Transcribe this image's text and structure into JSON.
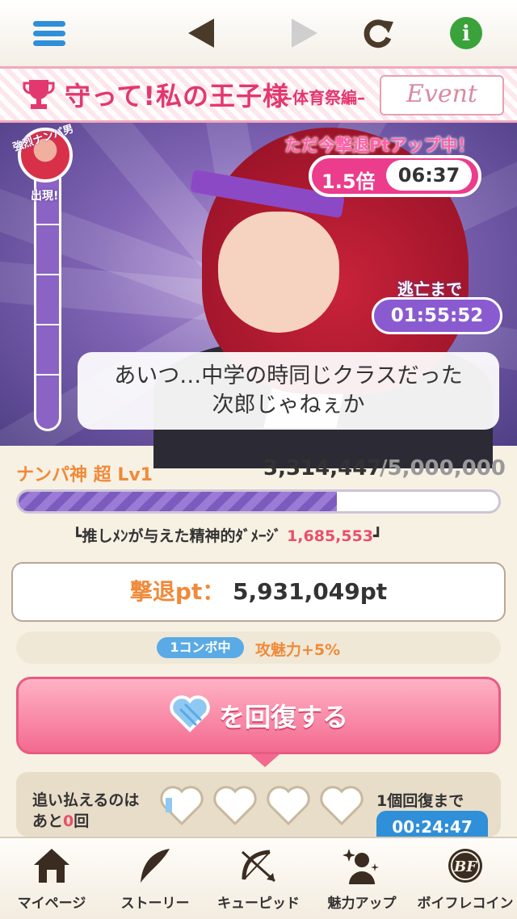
{
  "topbar": {
    "menu_icon": "hamburger-menu-icon",
    "back_icon": "back-arrow-icon",
    "forward_icon": "forward-arrow-icon",
    "reload_icon": "reload-icon",
    "info_icon": "info-icon",
    "info_glyph": "i"
  },
  "event": {
    "title": "守って!私の王子様",
    "subtitle": "–体育祭編–",
    "badge": "Event"
  },
  "gauge": {
    "top_label": "強烈ナンパ男",
    "bottom_label": "出現!",
    "fill_fraction": 1.0
  },
  "boost": {
    "title": "ただ今撃退Ptアップ中！",
    "multiplier": "1.5倍",
    "remaining": "06:37"
  },
  "escape": {
    "label": "逃亡まで",
    "time": "01:55:52"
  },
  "speech": {
    "line1": "あいつ…中学の時同じクラスだった",
    "line2": "次郎じゃねぇか"
  },
  "boss": {
    "name": "ナンパ神 超 Lv1",
    "hp_current": "3,314,447",
    "hp_max": "/5,000,000",
    "hp_fraction": 0.663
  },
  "damage": {
    "label": "┗推しﾒﾝが与えた精神的ﾀﾞﾒｰｼﾞ",
    "value": "1,685,553",
    "end": "┛"
  },
  "points": {
    "label": "撃退pt：",
    "value": "5,931,049pt"
  },
  "combo": {
    "badge": "1コンボ中",
    "bonus": "攻魅力+5%"
  },
  "recover": {
    "label": "を回復する",
    "icon": "heart-icon"
  },
  "stock": {
    "line1": "追い払えるのは",
    "line2_prefix": "あと",
    "line2_count": "0",
    "line2_suffix": "回",
    "hearts_total": 4,
    "next_label": "1個回復まで",
    "next_time": "00:24:47"
  },
  "nav": {
    "items": [
      {
        "label": "マイページ",
        "icon": "home-icon"
      },
      {
        "label": "ストーリー",
        "icon": "feather-quill-icon"
      },
      {
        "label": "キューピッド",
        "icon": "bow-arrow-icon"
      },
      {
        "label": "魅力アップ",
        "icon": "sparkle-person-icon"
      },
      {
        "label": "ボイフレコイン",
        "icon": "coin-icon"
      }
    ],
    "coin_mark": "BF"
  }
}
